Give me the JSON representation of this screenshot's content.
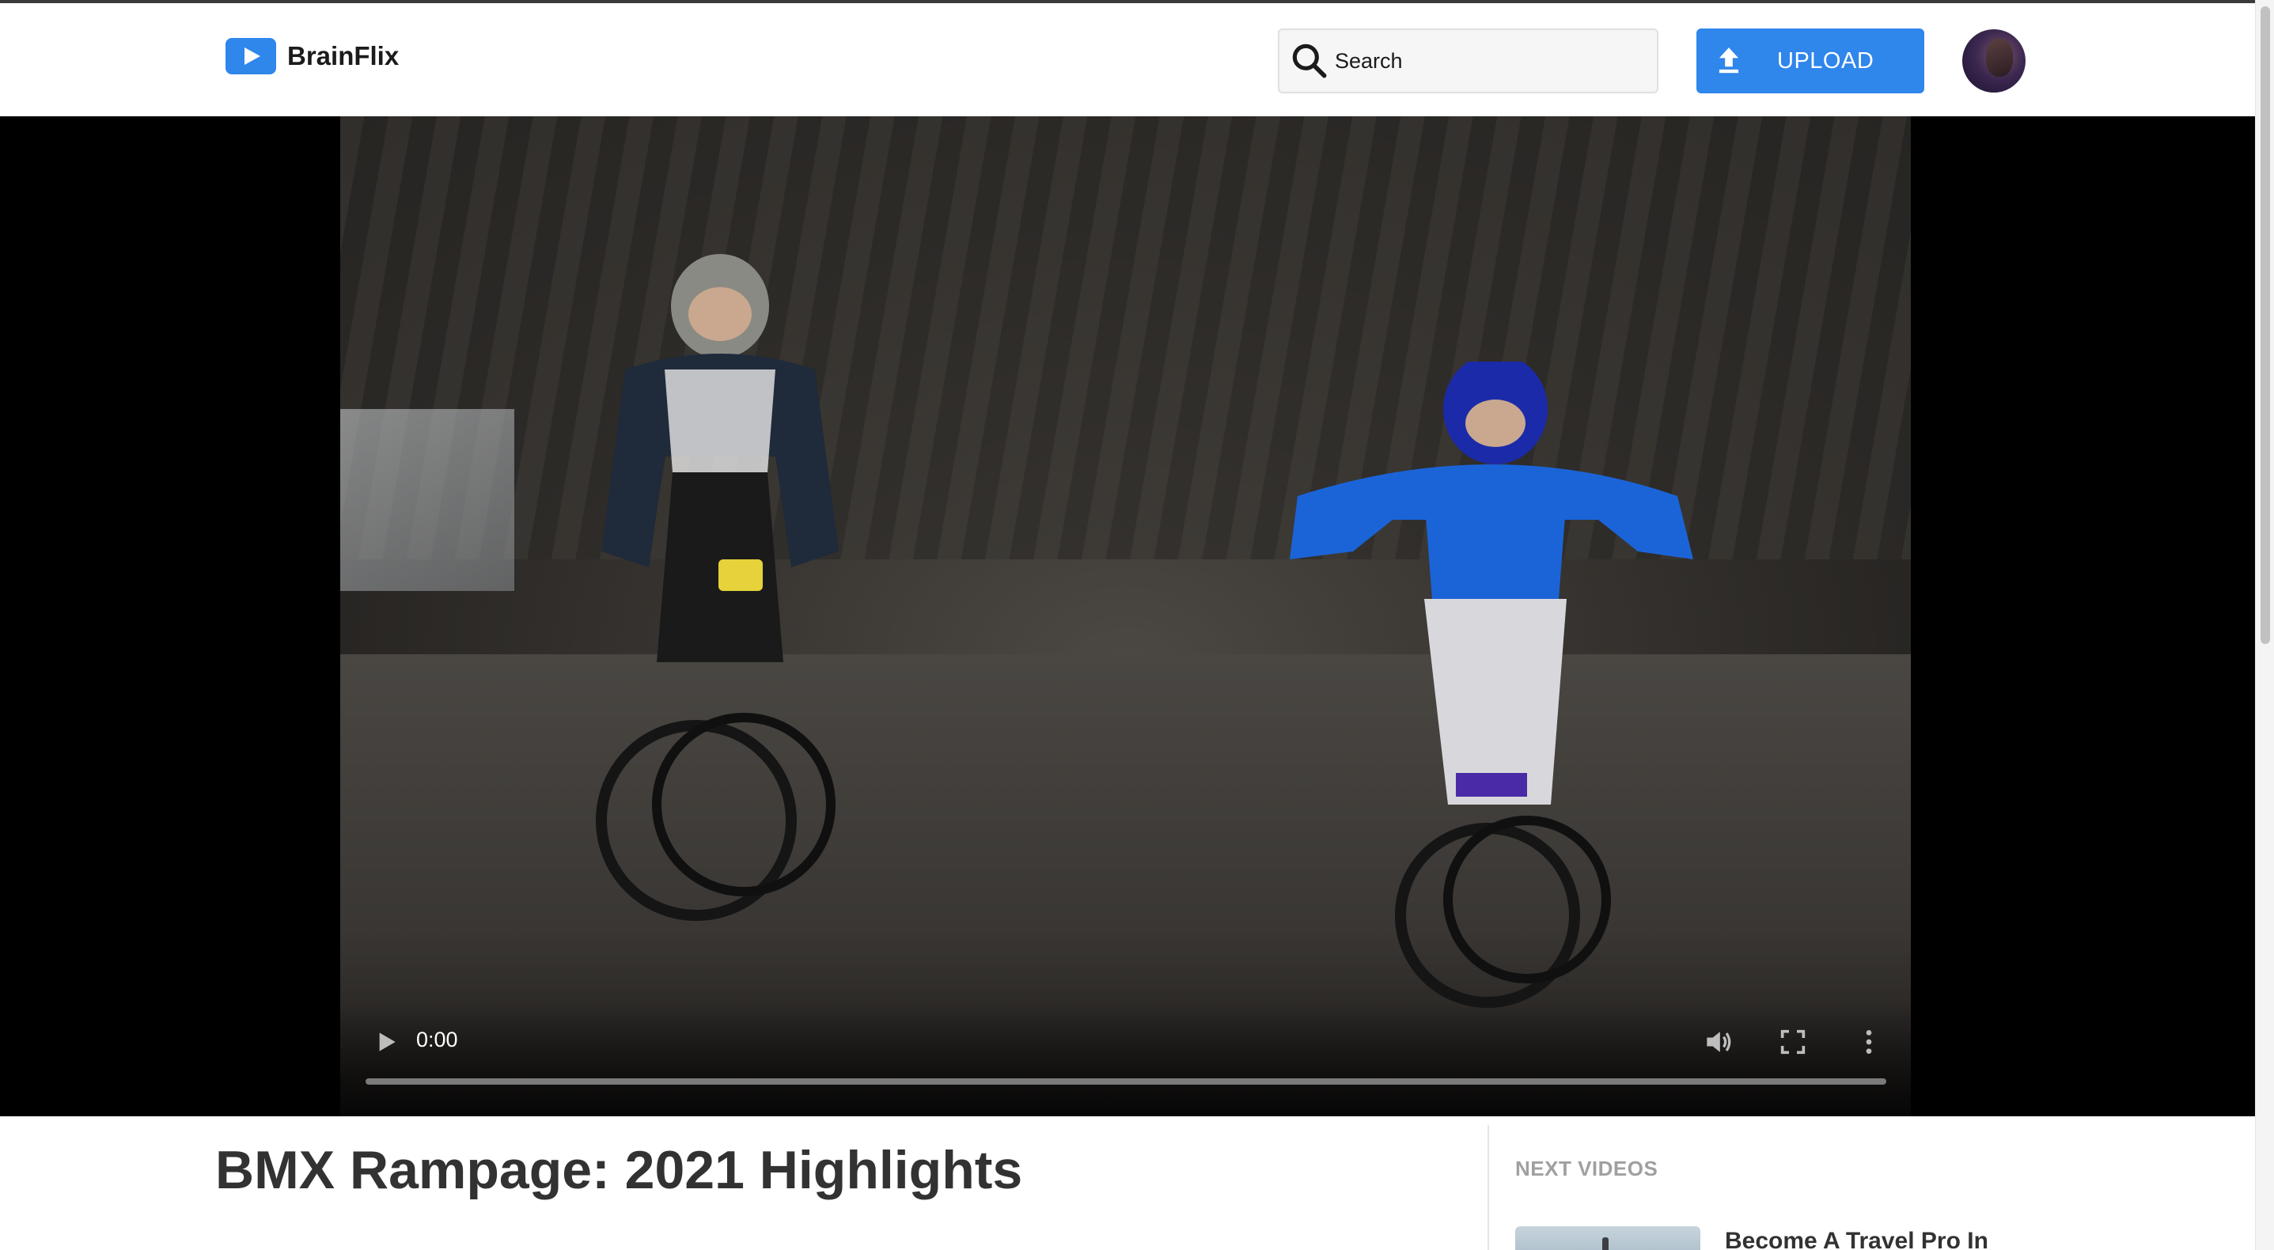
{
  "app": {
    "name": "BrainFlix"
  },
  "header": {
    "search_placeholder": "Search",
    "upload_label": "UPLOAD"
  },
  "player": {
    "current_time": "0:00",
    "progress": 0
  },
  "video": {
    "title": "BMX Rampage: 2021 Highlights"
  },
  "sidebar": {
    "heading": "NEXT VIDEOS",
    "items": [
      {
        "title": "Become A Travel Pro In"
      }
    ]
  },
  "colors": {
    "accent": "#2f86eb",
    "title_text": "#323232",
    "muted_text": "#a0a0a0"
  },
  "icons": [
    "logo-play-icon",
    "search-icon",
    "upload-icon",
    "play-icon",
    "volume-icon",
    "fullscreen-icon",
    "more-options-icon"
  ]
}
